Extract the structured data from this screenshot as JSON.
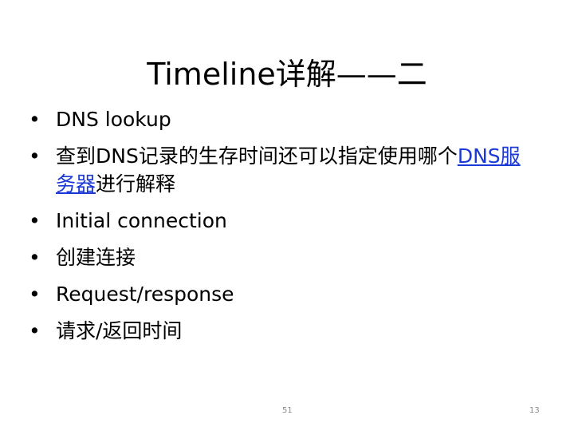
{
  "slide": {
    "title": "Timeline详解——二",
    "bullets": [
      {
        "text": "DNS lookup"
      },
      {
        "prefix": "查到DNS记录的生存时间还可以指定使用哪个",
        "link": "DNS服务器",
        "suffix": "进行解释"
      },
      {
        "text": "Initial connection"
      },
      {
        "text": "创建连接"
      },
      {
        "text": "Request/response"
      },
      {
        "text": "请求/返回时间"
      }
    ],
    "bullet_symbol": "•",
    "footer": {
      "center_number": "51",
      "right_number": "13"
    },
    "colors": {
      "link": "#1a39d6",
      "footer": "#8a8a8a"
    }
  }
}
